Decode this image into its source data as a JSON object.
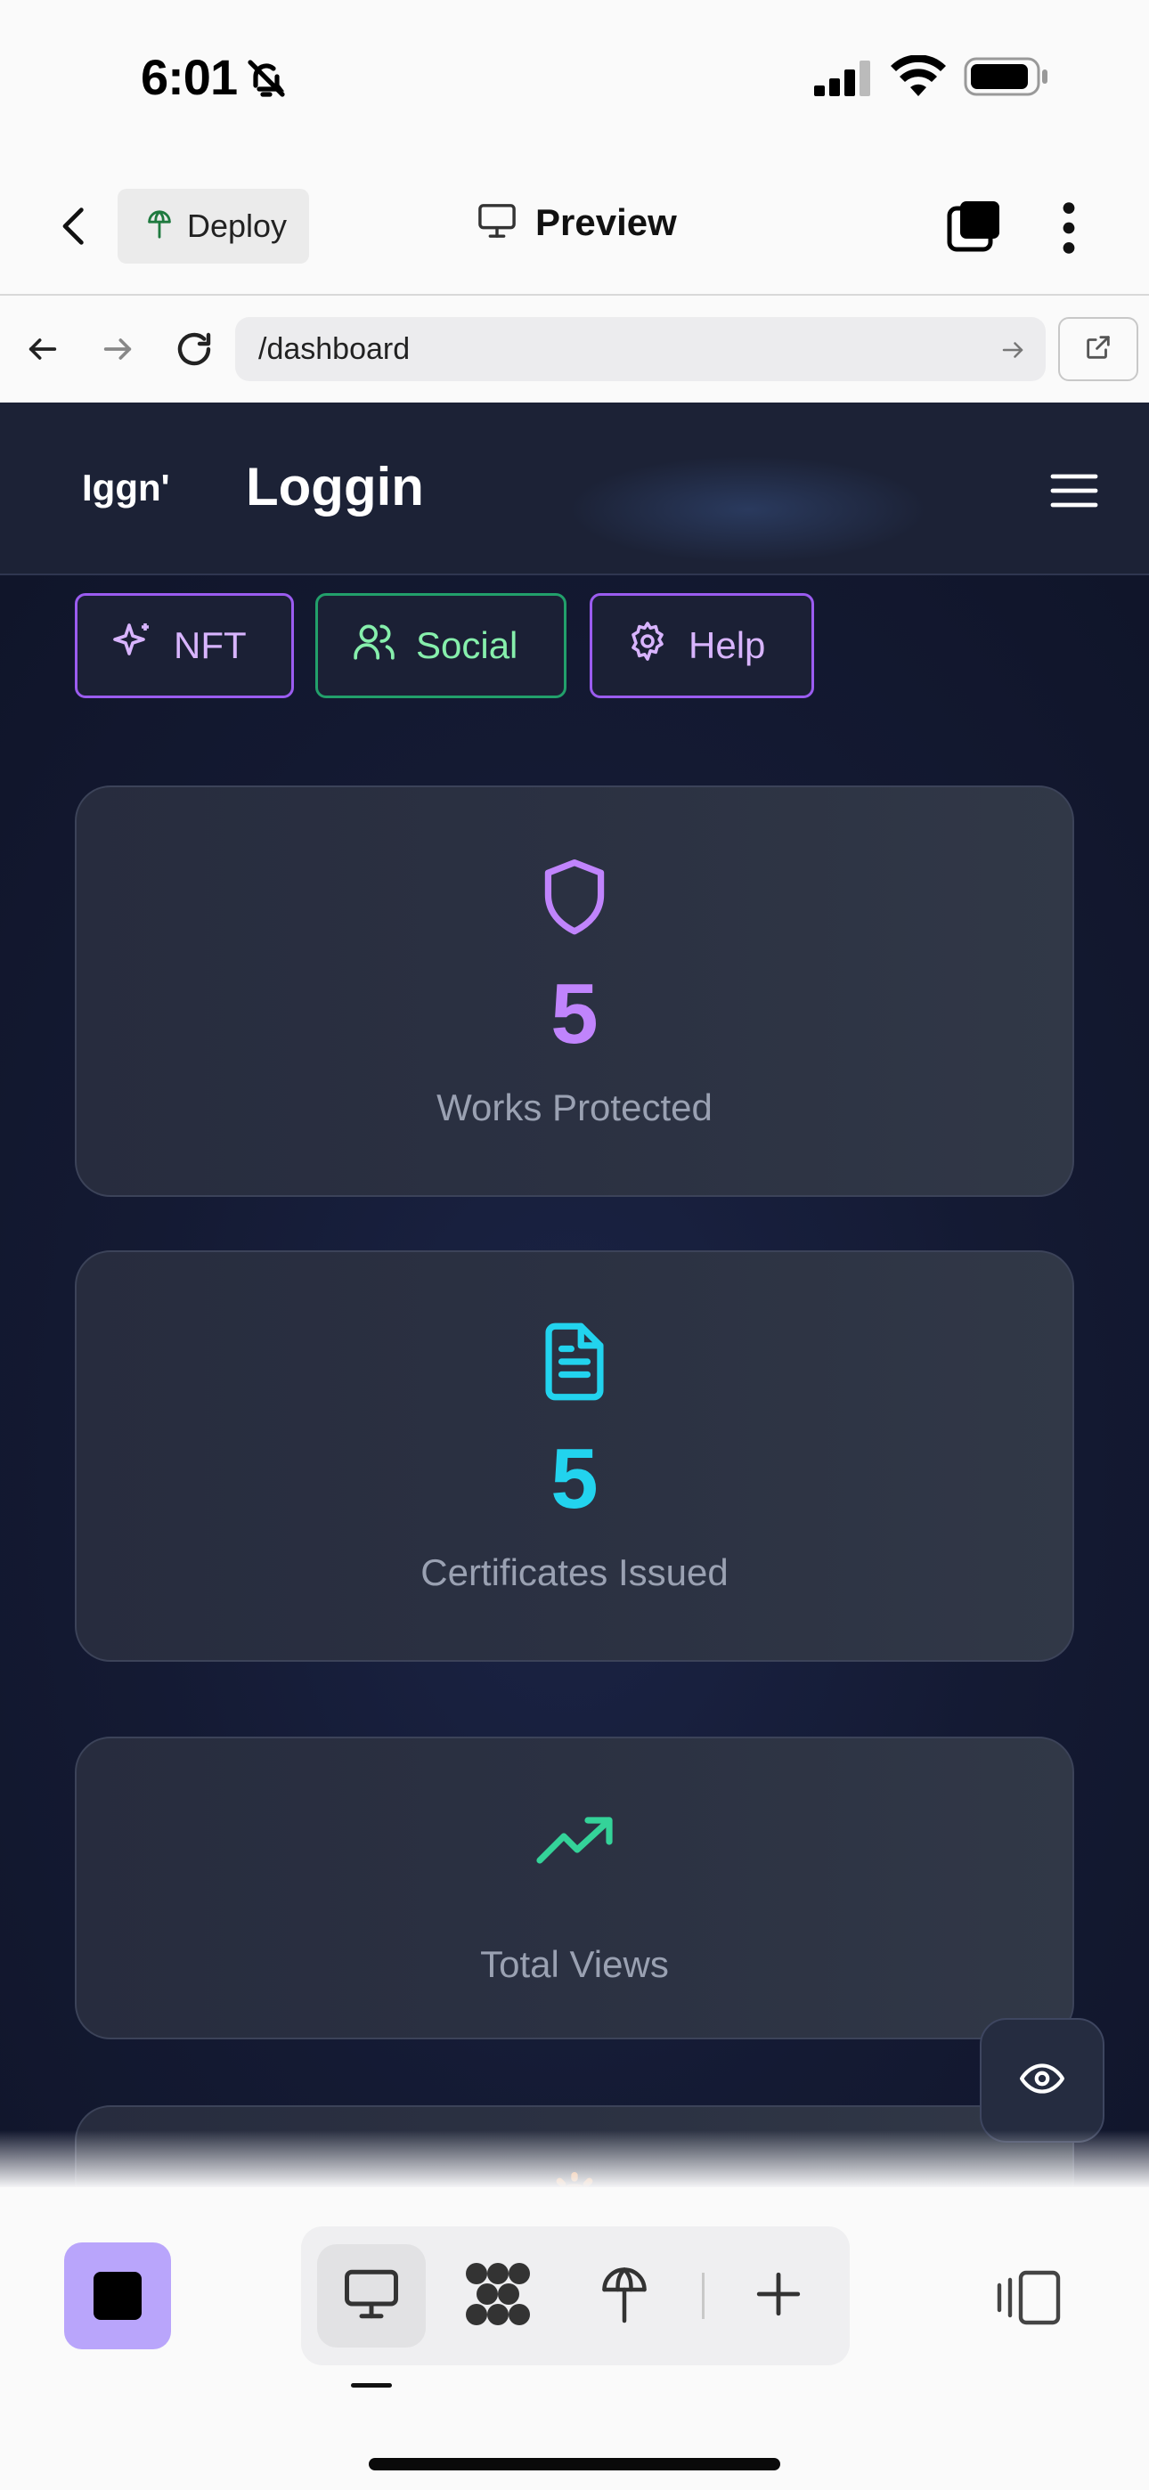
{
  "status_bar": {
    "time": "6:01"
  },
  "app_header": {
    "deploy_label": "Deploy",
    "preview_label": "Preview"
  },
  "browser": {
    "url": "/dashboard"
  },
  "site": {
    "logo_text": "Iggn'",
    "title": "Loggin",
    "pills": [
      {
        "label": "NFT",
        "icon": "sparkles-icon"
      },
      {
        "label": "Social",
        "icon": "users-icon"
      },
      {
        "label": "Help",
        "icon": "gear-icon"
      }
    ],
    "stats": [
      {
        "value": "5",
        "caption": "Works Protected",
        "icon": "shield-icon",
        "color": "#c084fc"
      },
      {
        "value": "5",
        "caption": "Certificates Issued",
        "icon": "document-icon",
        "color": "#22d3ee"
      },
      {
        "value": "",
        "caption": "Total Views",
        "icon": "trending-up-icon",
        "color": "#34d399"
      }
    ]
  },
  "colors": {
    "purple_accent": "#9b5cf0",
    "green_accent": "#22a06b",
    "stop_button": "#b9a5fb"
  }
}
